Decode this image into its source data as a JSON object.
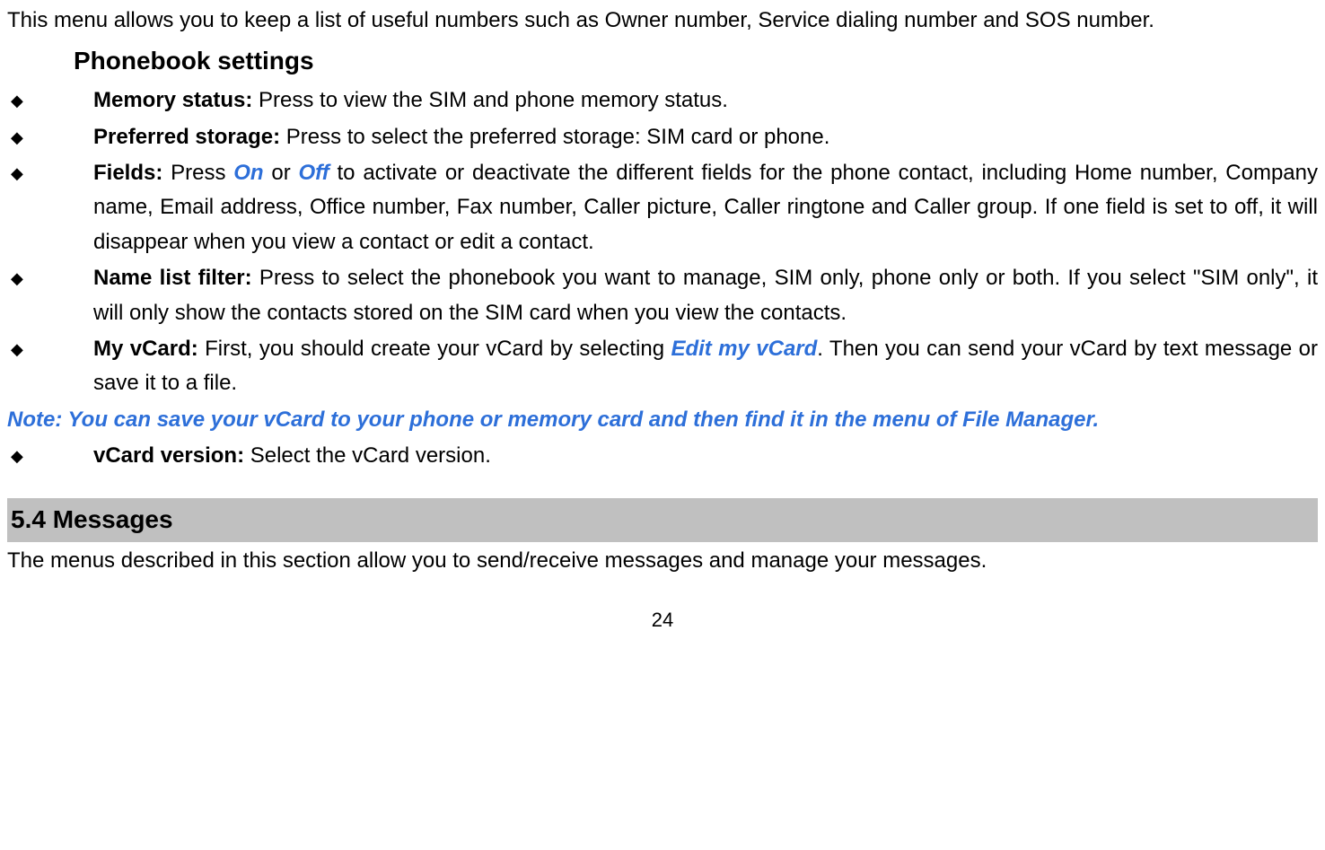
{
  "intro": "This menu allows you to keep a list of useful numbers such as Owner number, Service dialing number and SOS number.",
  "subheading": "Phonebook settings",
  "bullets": [
    {
      "label": "Memory status:",
      "text": " Press to view the SIM and phone memory status."
    },
    {
      "label": "Preferred storage:",
      "text": " Press to select the preferred storage: SIM card or phone."
    },
    {
      "label": "Fields:",
      "pre": " Press ",
      "emph1": "On",
      "mid": " or ",
      "emph2": "Off",
      "post": " to activate or deactivate the different fields for the phone contact, including Home number, Company name, Email address, Office number, Fax number, Caller picture, Caller ringtone and Caller group. If one field is set to off, it will disappear when you view a contact or edit a contact."
    },
    {
      "label": "Name list filter:",
      "text": " Press to select the phonebook you want to manage, SIM only, phone only or both. If you select \"SIM only\", it will only show the contacts stored on the SIM card when you view the contacts."
    },
    {
      "label": "My vCard:",
      "pre": " First, you should create your vCard by selecting ",
      "emph1": "Edit my vCard",
      "post": ". Then you can send your vCard by text message or save it to a file."
    }
  ],
  "note": "Note: You can save your vCard to your phone or memory card and then find it in the menu of File Manager.",
  "bullets2": [
    {
      "label": "vCard version:",
      "text": " Select the vCard version."
    }
  ],
  "section": {
    "heading": "5.4  Messages",
    "body": "The menus described in this section allow you to send/receive messages and manage your messages."
  },
  "pageNumber": "24"
}
